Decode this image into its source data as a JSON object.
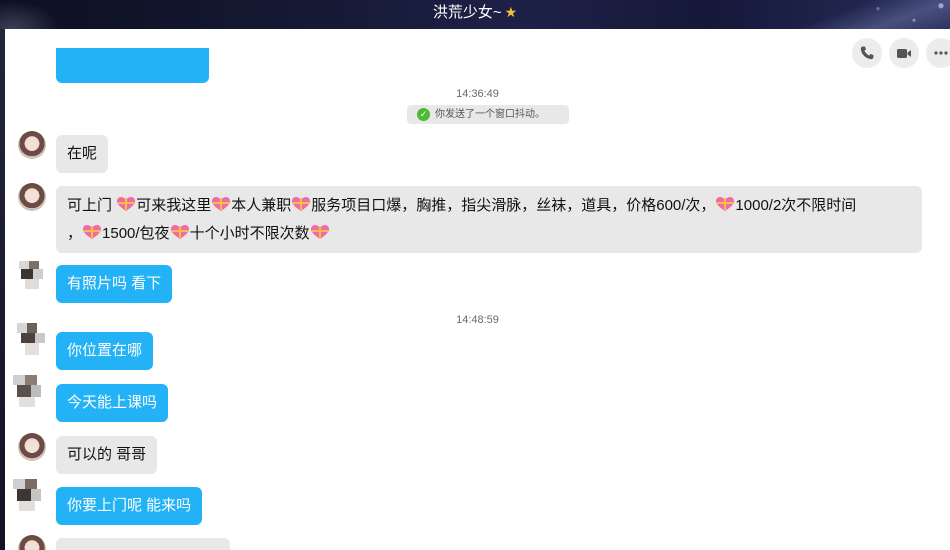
{
  "window": {
    "title": "洪荒少女~",
    "title_icon": "star-icon"
  },
  "toolbar": {
    "buttons": [
      "phone-icon",
      "video-icon",
      "more-icon"
    ]
  },
  "messages": {
    "time_1": "14:36:49",
    "system_notice": "你发送了一个窗口抖动。",
    "m1": "在呢",
    "m2_line1_a": "可上门",
    "m2_line1_b": "可来我这里",
    "m2_line1_c": "本人兼职",
    "m2_line1_d": "服务项目口爆，胸推，指尖滑脉，丝袜，道具，价格600/次，",
    "m2_line1_e": "1000/2次不限时间",
    "m2_line2_a": "，",
    "m2_line2_b": "1500/包夜",
    "m2_line2_c": "十个小时不限次数",
    "m3": "有照片吗 看下",
    "time_2": "14:48:59",
    "m4": "你位置在哪",
    "m5": "今天能上课吗",
    "m6": "可以的 哥哥",
    "m7": "你要上门呢 能来吗"
  },
  "colors": {
    "outgoing_bubble": "#22b2f5",
    "incoming_bubble": "#e8e8e8",
    "title_bar": "#161a36",
    "check": "#4cba38"
  }
}
